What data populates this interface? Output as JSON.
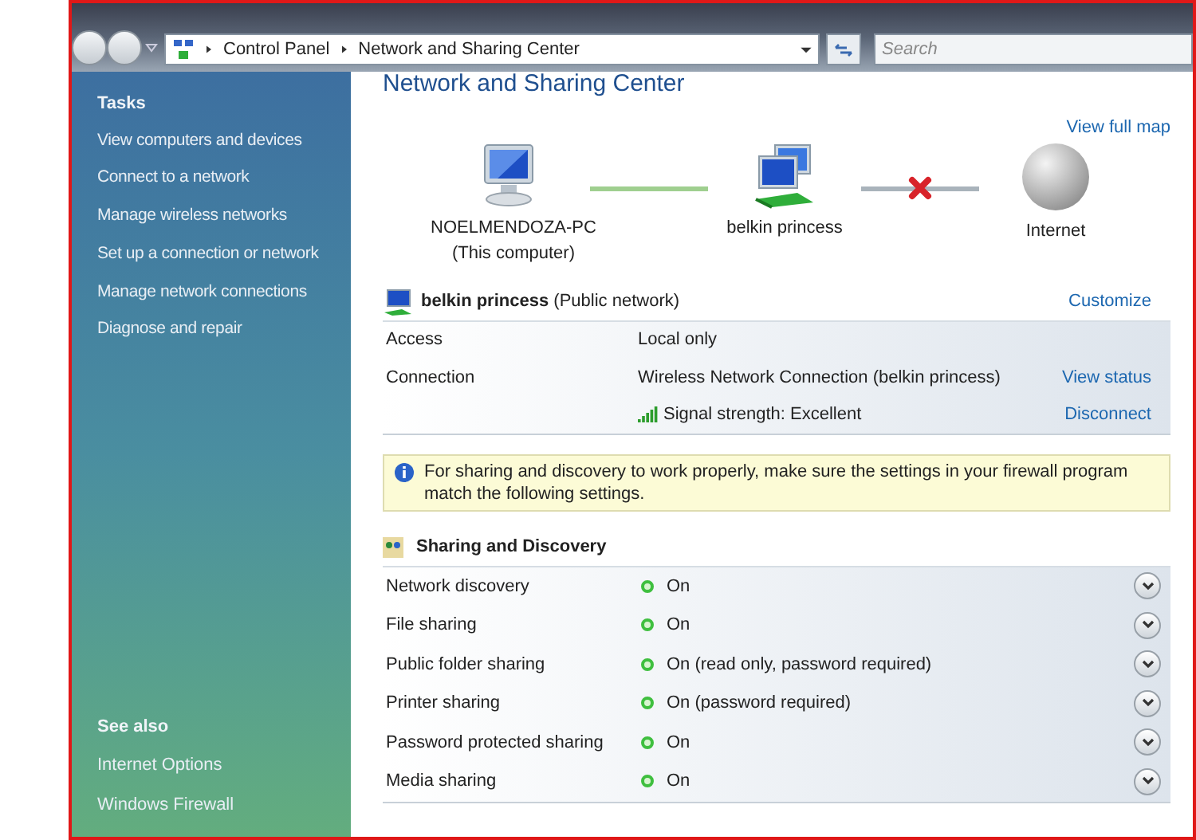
{
  "address_bar": {
    "crumbs": [
      "Control Panel",
      "Network and Sharing Center"
    ]
  },
  "search": {
    "placeholder": "Search"
  },
  "sidebar": {
    "tasks_title": "Tasks",
    "tasks": [
      "View computers and devices",
      "Connect to a network",
      "Manage wireless networks",
      "Set up a connection or network",
      "Manage network connections",
      "Diagnose and repair"
    ],
    "see_also_title": "See also",
    "see_also": [
      "Internet Options",
      "Windows Firewall"
    ]
  },
  "page_title": "Network and Sharing Center",
  "map": {
    "view_full_map": "View full map",
    "nodes": [
      {
        "kind": "computer",
        "label": "NOELMENDOZA-PC",
        "sublabel": "(This computer)"
      },
      {
        "kind": "network",
        "label": "belkin princess"
      },
      {
        "kind": "internet",
        "label": "Internet"
      }
    ],
    "links": [
      {
        "broken": false
      },
      {
        "broken": true
      }
    ]
  },
  "network": {
    "name": "belkin princess",
    "type": "(Public network)",
    "customize": "Customize",
    "rows": [
      {
        "label": "Access",
        "value": "Local only"
      },
      {
        "label": "Connection",
        "value": "Wireless Network Connection (belkin princess)",
        "link": "View status"
      },
      {
        "kind": "signal",
        "value": "Signal strength:  Excellent",
        "link": "Disconnect"
      }
    ]
  },
  "info": "For sharing and discovery to work properly, make sure the settings in your firewall program match the following settings.",
  "sharing": {
    "title": "Sharing and Discovery",
    "rows": [
      {
        "label": "Network discovery",
        "value": "On",
        "on": true
      },
      {
        "label": "File sharing",
        "value": "On",
        "on": true
      },
      {
        "label": "Public folder sharing",
        "value": "On (read only, password required)",
        "on": true
      },
      {
        "label": "Printer sharing",
        "value": "On (password required)",
        "on": true
      },
      {
        "label": "Password protected sharing",
        "value": "On",
        "on": true
      },
      {
        "label": "Media sharing",
        "value": "On",
        "on": true
      }
    ]
  }
}
